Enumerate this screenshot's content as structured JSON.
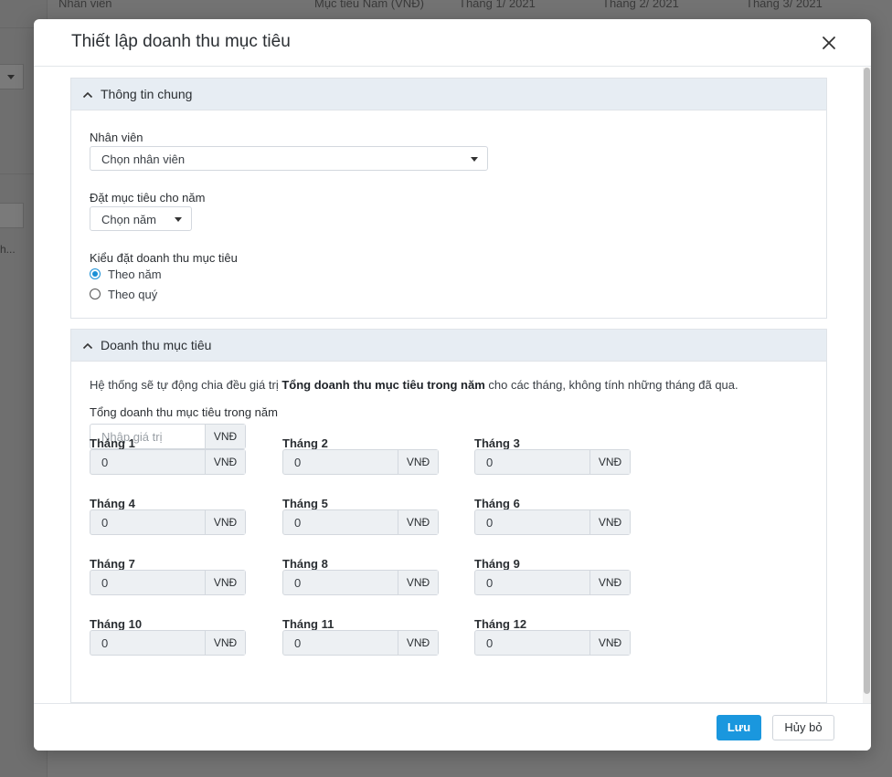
{
  "background": {
    "columns": [
      "Nhân viên",
      "Mục tiêu Năm (VNĐ)",
      "Tháng 1/ 2021",
      "Tháng 2/ 2021",
      "Tháng 3/ 2021"
    ],
    "truncated_text": "h..."
  },
  "modal": {
    "title": "Thiết lập doanh thu mục tiêu",
    "close_icon": "close-icon"
  },
  "general": {
    "title": "Thông tin chung",
    "employee_label": "Nhân viên",
    "employee_placeholder": "Chọn nhân viên",
    "year_label": "Đặt mục tiêu cho năm",
    "year_placeholder": "Chọn năm",
    "type_label": "Kiểu đặt doanh thu mục tiêu",
    "options": [
      {
        "label": "Theo năm",
        "checked": true
      },
      {
        "label": "Theo quý",
        "checked": false
      }
    ]
  },
  "revenue": {
    "title": "Doanh thu mục tiêu",
    "desc_before": "Hệ thống sẽ tự động chia đều giá trị ",
    "desc_bold": "Tổng doanh thu mục tiêu trong năm",
    "desc_after": " cho các tháng, không tính những tháng đã qua.",
    "total_label": "Tổng doanh thu mục tiêu trong năm",
    "total_placeholder": "Nhập giá trị",
    "unit": "VNĐ",
    "months": [
      {
        "label": "Tháng 1",
        "value": "0"
      },
      {
        "label": "Tháng 2",
        "value": "0"
      },
      {
        "label": "Tháng 3",
        "value": "0"
      },
      {
        "label": "Tháng 4",
        "value": "0"
      },
      {
        "label": "Tháng 5",
        "value": "0"
      },
      {
        "label": "Tháng 6",
        "value": "0"
      },
      {
        "label": "Tháng 7",
        "value": "0"
      },
      {
        "label": "Tháng 8",
        "value": "0"
      },
      {
        "label": "Tháng 9",
        "value": "0"
      },
      {
        "label": "Tháng 10",
        "value": "0"
      },
      {
        "label": "Tháng 11",
        "value": "0"
      },
      {
        "label": "Tháng 12",
        "value": "0"
      }
    ]
  },
  "footer": {
    "save_label": "Lưu",
    "cancel_label": "Hủy bỏ"
  },
  "colors": {
    "primary": "#1a97de",
    "section_header": "#e7edf3",
    "readonly_input": "#edf0f3",
    "overlay": "#737373"
  }
}
